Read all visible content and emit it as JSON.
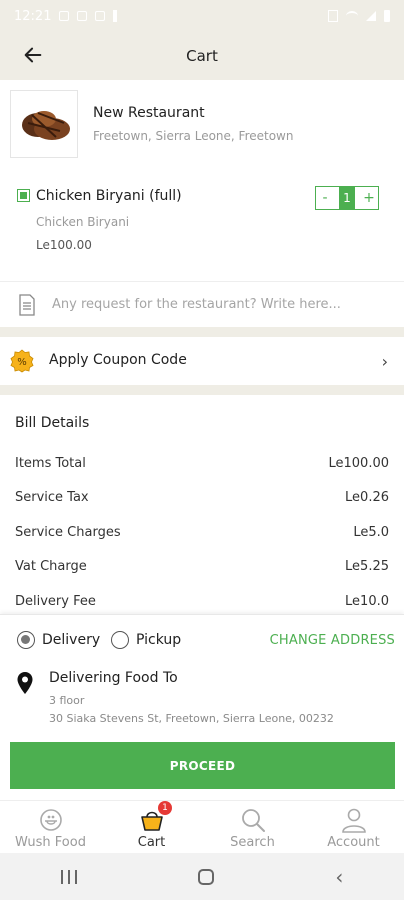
{
  "status_bar": {
    "time": "12:21"
  },
  "header": {
    "title": "Cart"
  },
  "restaurant": {
    "name": "New Restaurant",
    "location": "Freetown, Sierra Leone, Freetown"
  },
  "cart_item": {
    "name": "Chicken Biryani (full)",
    "subtitle": "Chicken Biryani",
    "price": "Le100.00",
    "quantity": "1",
    "minus_label": "-",
    "plus_label": "+"
  },
  "request": {
    "placeholder": "Any request for the restaurant? Write here..."
  },
  "coupon": {
    "label": "Apply Coupon Code",
    "chevron": "›"
  },
  "bill": {
    "title": "Bill Details",
    "rows": [
      {
        "label": "Items Total",
        "value": "Le100.00"
      },
      {
        "label": "Service Tax",
        "value": "Le0.26"
      },
      {
        "label": "Service Charges",
        "value": "Le5.0"
      },
      {
        "label": "Vat Charge",
        "value": "Le5.25"
      },
      {
        "label": "Delivery Fee",
        "value": "Le10.0"
      }
    ]
  },
  "delivery": {
    "option_delivery": "Delivery",
    "option_pickup": "Pickup",
    "change_address": "CHANGE ADDRESS",
    "title": "Delivering Food To",
    "address_line1": "3 floor",
    "address_line2": "30 Siaka Stevens St, Freetown, Sierra Leone, 00232",
    "proceed": "PROCEED"
  },
  "tabs": [
    {
      "label": "Wush Food"
    },
    {
      "label": "Cart",
      "badge": "1"
    },
    {
      "label": "Search"
    },
    {
      "label": "Account"
    }
  ],
  "colors": {
    "accent": "#4caf50",
    "header_bg": "#efede5",
    "badge": "#e53935"
  }
}
